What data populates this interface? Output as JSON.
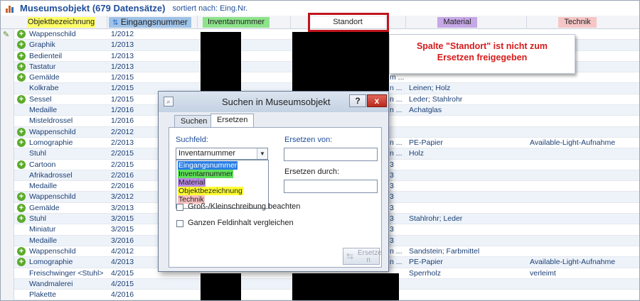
{
  "window": {
    "title": "Museumsobjekt (679 Datensätze)",
    "sort_label": "sortiert nach: Eing.Nr."
  },
  "columns": [
    {
      "label": "Objektbezeichnung",
      "color": "#ffff66"
    },
    {
      "label": "Eingangsnummer",
      "color": "#9fc2e7"
    },
    {
      "label": "Inventarnummer",
      "color": "#8de38a"
    },
    {
      "label": "Standort",
      "color": "#ffffff"
    },
    {
      "label": "Material",
      "color": "#c6a8e6"
    },
    {
      "label": "Technik",
      "color": "#f6c6c6"
    }
  ],
  "rows": [
    {
      "add": true,
      "edit": true,
      "name": "Wappenschild",
      "nr": "1/2012",
      "inv_part": "",
      "material": "",
      "technik": ""
    },
    {
      "add": true,
      "name": "Graphik",
      "nr": "1/2013",
      "inv_part": "",
      "material": "",
      "technik": ""
    },
    {
      "add": true,
      "name": "Bedienteil",
      "nr": "1/2013",
      "inv_part": "",
      "material": "",
      "technik": ""
    },
    {
      "add": true,
      "name": "Tastatur",
      "nr": "1/2013",
      "inv_part": "",
      "material": "",
      "technik": ""
    },
    {
      "add": true,
      "name": "Gemälde",
      "nr": "1/2015",
      "inv_part": "m ...",
      "material": "",
      "technik": ""
    },
    {
      "add": false,
      "name": "Kolkrabe",
      "nr": "1/2015",
      "inv_part": "n ...",
      "material": "Leinen; Holz",
      "technik": ""
    },
    {
      "add": true,
      "name": "Sessel",
      "nr": "1/2015",
      "inv_part": "n ...",
      "material": "Leder; Stahlrohr",
      "technik": ""
    },
    {
      "add": false,
      "name": "Medaille",
      "nr": "1/2016",
      "inv_part": "n ...",
      "material": "Achatglas",
      "technik": ""
    },
    {
      "add": false,
      "name": "Misteldrossel",
      "nr": "1/2016",
      "inv_part": "",
      "material": "",
      "technik": ""
    },
    {
      "add": true,
      "name": "Wappenschild",
      "nr": "2/2012",
      "inv_part": "",
      "material": "",
      "technik": ""
    },
    {
      "add": true,
      "name": "Lomographie",
      "nr": "2/2013",
      "inv_part": "n ...",
      "material": "PE-Papier",
      "technik": "Available-Light-Aufnahme"
    },
    {
      "add": false,
      "name": "Stuhl",
      "nr": "2/2015",
      "inv_part": "n ...",
      "material": "Holz",
      "technik": ""
    },
    {
      "add": true,
      "name": "Cartoon",
      "nr": "2/2015",
      "inv_part": "3",
      "material": "",
      "technik": ""
    },
    {
      "add": false,
      "name": "Afrikadrossel",
      "nr": "2/2016",
      "inv_part": "3",
      "material": "",
      "technik": ""
    },
    {
      "add": false,
      "name": "Medaille",
      "nr": "2/2016",
      "inv_part": "3",
      "material": "",
      "technik": ""
    },
    {
      "add": true,
      "name": "Wappenschild",
      "nr": "3/2012",
      "inv_part": "3",
      "material": "",
      "technik": ""
    },
    {
      "add": true,
      "name": "Gemälde",
      "nr": "3/2013",
      "inv_part": "3",
      "material": "",
      "technik": ""
    },
    {
      "add": true,
      "name": "Stuhl",
      "nr": "3/2015",
      "inv_part": "3",
      "material": "Stahlrohr; Leder",
      "technik": ""
    },
    {
      "add": false,
      "name": "Miniatur",
      "nr": "3/2015",
      "inv_part": "3",
      "material": "",
      "technik": ""
    },
    {
      "add": false,
      "name": "Medaille",
      "nr": "3/2016",
      "inv_part": "3",
      "material": "",
      "technik": ""
    },
    {
      "add": true,
      "name": "Wappenschild",
      "nr": "4/2012",
      "inv_part": "n ...",
      "material": "Sandstein; Farbmittel",
      "technik": ""
    },
    {
      "add": true,
      "name": "Lomographie",
      "nr": "4/2013",
      "inv_part": "n ...",
      "material": "PE-Papier",
      "technik": "Available-Light-Aufnahme"
    },
    {
      "add": false,
      "name": "Freischwinger <Stuhl>",
      "nr": "4/2015",
      "inv_part": "",
      "material": "Sperrholz",
      "technik": "verleimt"
    },
    {
      "add": false,
      "name": "Wandmalerei",
      "nr": "4/2015",
      "inv_part": "",
      "material": "",
      "technik": ""
    },
    {
      "add": false,
      "name": "Plakette",
      "nr": "4/2016",
      "inv_part": "",
      "material": "",
      "technik": ""
    }
  ],
  "callout": {
    "line1": "Spalte \"Standort\" ist nicht zum",
    "line2": "Ersetzen freigegeben",
    "color": "#d61a1a"
  },
  "dialog": {
    "title": "Suchen in Museumsobjekt",
    "help_label": "?",
    "close_label": "x",
    "tabs": [
      "Suchen",
      "Ersetzen"
    ],
    "suchfeld_label": "Suchfeld:",
    "suchfeld_value": "Inventarnummer",
    "options": [
      {
        "label": "Eingangsnummer",
        "color": "#2a7ee6",
        "text_color": "#ffffff"
      },
      {
        "label": "Inventarnummer",
        "color": "#5fe05a",
        "text_color": "#222222"
      },
      {
        "label": "Material",
        "color": "#b98ae6",
        "text_color": "#222222"
      },
      {
        "label": "Objektbezeichnung",
        "color": "#ffff33",
        "text_color": "#222222"
      },
      {
        "label": "Technik",
        "color": "#f6c0c0",
        "text_color": "#222222"
      }
    ],
    "ersetzen_von_label": "Ersetzen von:",
    "ersetzen_durch_label": "Ersetzen durch:",
    "check_case": "Groß-/Kleinschreibung beachten",
    "check_whole": "Ganzen Feldinhalt vergleichen",
    "button_line1": "Ersetze",
    "button_line2": "n"
  }
}
